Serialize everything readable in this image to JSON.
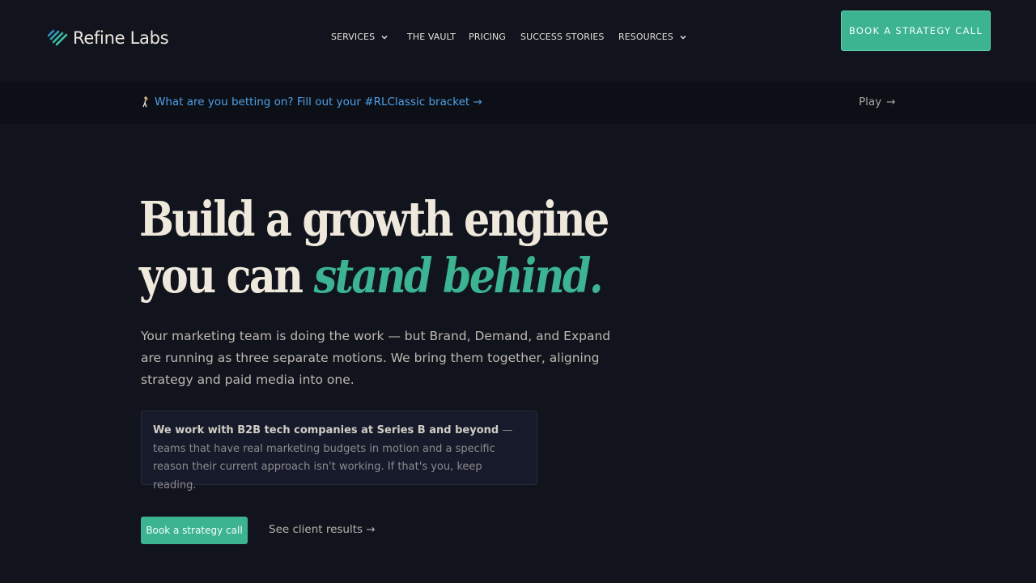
{
  "header": {
    "logo_text": "Refine Labs",
    "logo_icon": "stripes-logo-icon",
    "nav": [
      {
        "label": "SERVICES",
        "has_dropdown": true
      },
      {
        "label": "THE VAULT",
        "has_dropdown": false
      },
      {
        "label": "PRICING",
        "has_dropdown": false
      },
      {
        "label": "SUCCESS STORIES",
        "has_dropdown": false
      },
      {
        "label": "RESOURCES",
        "has_dropdown": true
      }
    ],
    "cta_label": "BOOK A STRATEGY CALL"
  },
  "announcement": {
    "emoji_icon": "golfer-icon",
    "text": "What are you betting on? Fill out your #RLClassic bracket →",
    "play_label": "Play",
    "play_arrow": "→"
  },
  "hero": {
    "title_line1": "Build a growth engine",
    "title_line2_plain": "you can ",
    "title_line2_accent": "stand behind.",
    "subtitle": "Your marketing team is doing the work — but Brand, Demand, and Expand are running as three separate motions. We bring them together, aligning strategy and paid media into one.",
    "callout_bold": "We work with B2B tech companies at Series B and beyond",
    "callout_rest": " — teams that have real marketing budgets in motion and a specific reason their current approach isn't working. If that's you, keep reading.",
    "primary_button": "Book a strategy call",
    "secondary_link": "See client results →"
  },
  "colors": {
    "background": "#12141d",
    "announcement_bg": "#0d0f16",
    "accent": "#3cb391",
    "link_blue": "#4ea0e8",
    "heading": "#efe8dc"
  }
}
